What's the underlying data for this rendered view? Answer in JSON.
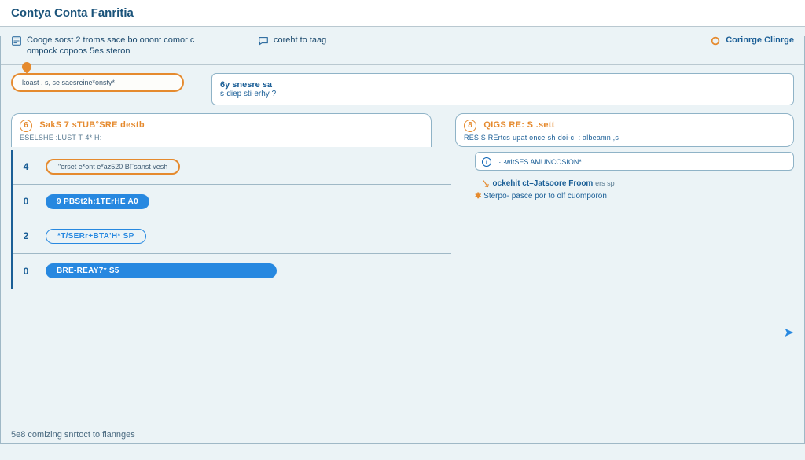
{
  "header": {
    "title": "Contya Conta Fanritia"
  },
  "tabs": [
    {
      "icon": "page-icon",
      "label": "Cooge sorst 2 troms sace bo onont comor c ompock copoos 5es steron"
    },
    {
      "icon": "chat-icon",
      "label": "coreht to taag"
    },
    {
      "icon": "dot-icon",
      "label": "Corinrge Clinrge"
    }
  ],
  "highlight": {
    "text": "koast , s, se saesreine*onsty*"
  },
  "panel": {
    "line1": "6y snesre sa",
    "line2": "s·diep sti·erhy ?"
  },
  "cards": [
    {
      "num": "6",
      "title": "SakS 7 sTUB°SRE destb",
      "sub": "ESELSHE :LUST T·4* H:"
    },
    {
      "num": "8",
      "title": "QIGS RE: S  .sett",
      "sub": "RES S RErtcs·upat once·sh·doi-c. : albeamn ,s"
    }
  ],
  "list": {
    "rows": [
      {
        "num": "4",
        "type": "oval",
        "label": "\"erset e*ont e*az520 BFsanst vesh"
      },
      {
        "num": "0",
        "type": "blue",
        "label": "9 PBSt2h:1TErHE A0"
      },
      {
        "num": "2",
        "type": "outline",
        "label": "*T/SERr+BTA'H* SP"
      },
      {
        "num": "0",
        "type": "blue",
        "label": "BRE-REAY7* S5"
      }
    ],
    "side_badge": "· ·wItSES AMUNCOSION* ",
    "note1_k": "ockehit ct–Jatsoore Froom",
    "note1_sub": "ers sp",
    "note2": "Sterpo- pasce por to olf cuomporon"
  },
  "footer": "5e8 comizing snrtoct to flannges",
  "colors": {
    "orange": "#e58a2e",
    "blue": "#2788e0"
  }
}
